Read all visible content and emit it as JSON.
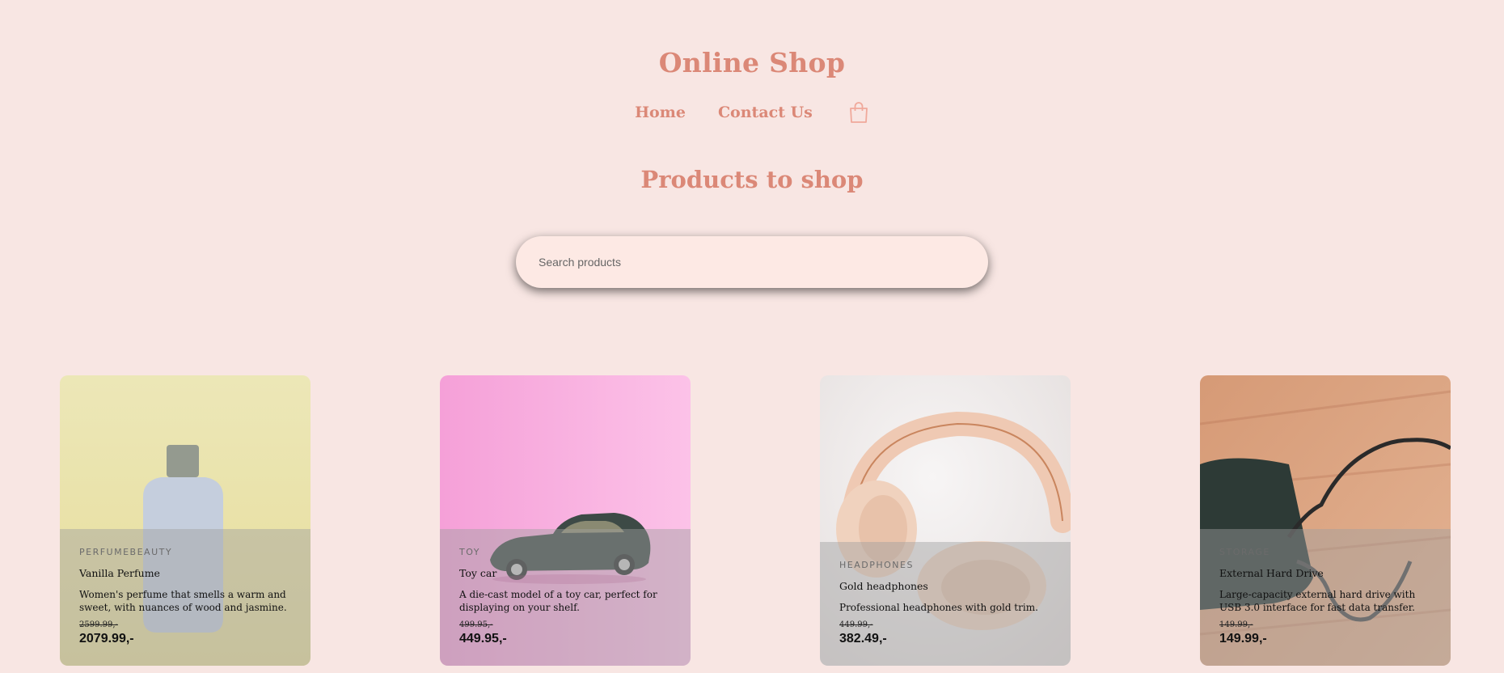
{
  "header": {
    "title": "Online Shop",
    "nav": {
      "home": "Home",
      "contact": "Contact Us"
    },
    "cart_icon": "shopping-bag-icon"
  },
  "main": {
    "section_title": "Products to shop",
    "search": {
      "placeholder": "Search products",
      "value": ""
    },
    "products": [
      {
        "category": "PERFUMEBEAUTY",
        "name": "Vanilla Perfume",
        "description": "Women's perfume that smells a warm and sweet, with nuances of wood and jasmine.",
        "old_price": "2599.99,-",
        "price": "2079.99,-",
        "image": "perfume-bottle-image"
      },
      {
        "category": "TOY",
        "name": "Toy car",
        "description": "A die-cast model of a toy car, perfect for displaying on your shelf.",
        "old_price": "499.95,-",
        "price": "449.95,-",
        "image": "toy-car-image"
      },
      {
        "category": "HEADPHONES",
        "name": "Gold headphones",
        "description": "Professional headphones with gold trim.",
        "old_price": "449.99,-",
        "price": "382.49,-",
        "image": "headphones-image"
      },
      {
        "category": "STORAGE",
        "name": "External Hard Drive",
        "description": "Large-capacity external hard drive with USB 3.0 interface for fast data transfer.",
        "old_price": "149.99,-",
        "price": "149.99,-",
        "image": "hard-drive-image"
      }
    ]
  },
  "colors": {
    "background": "#f8e6e3",
    "accent": "#db8877",
    "search_bg": "#fde9e4"
  }
}
